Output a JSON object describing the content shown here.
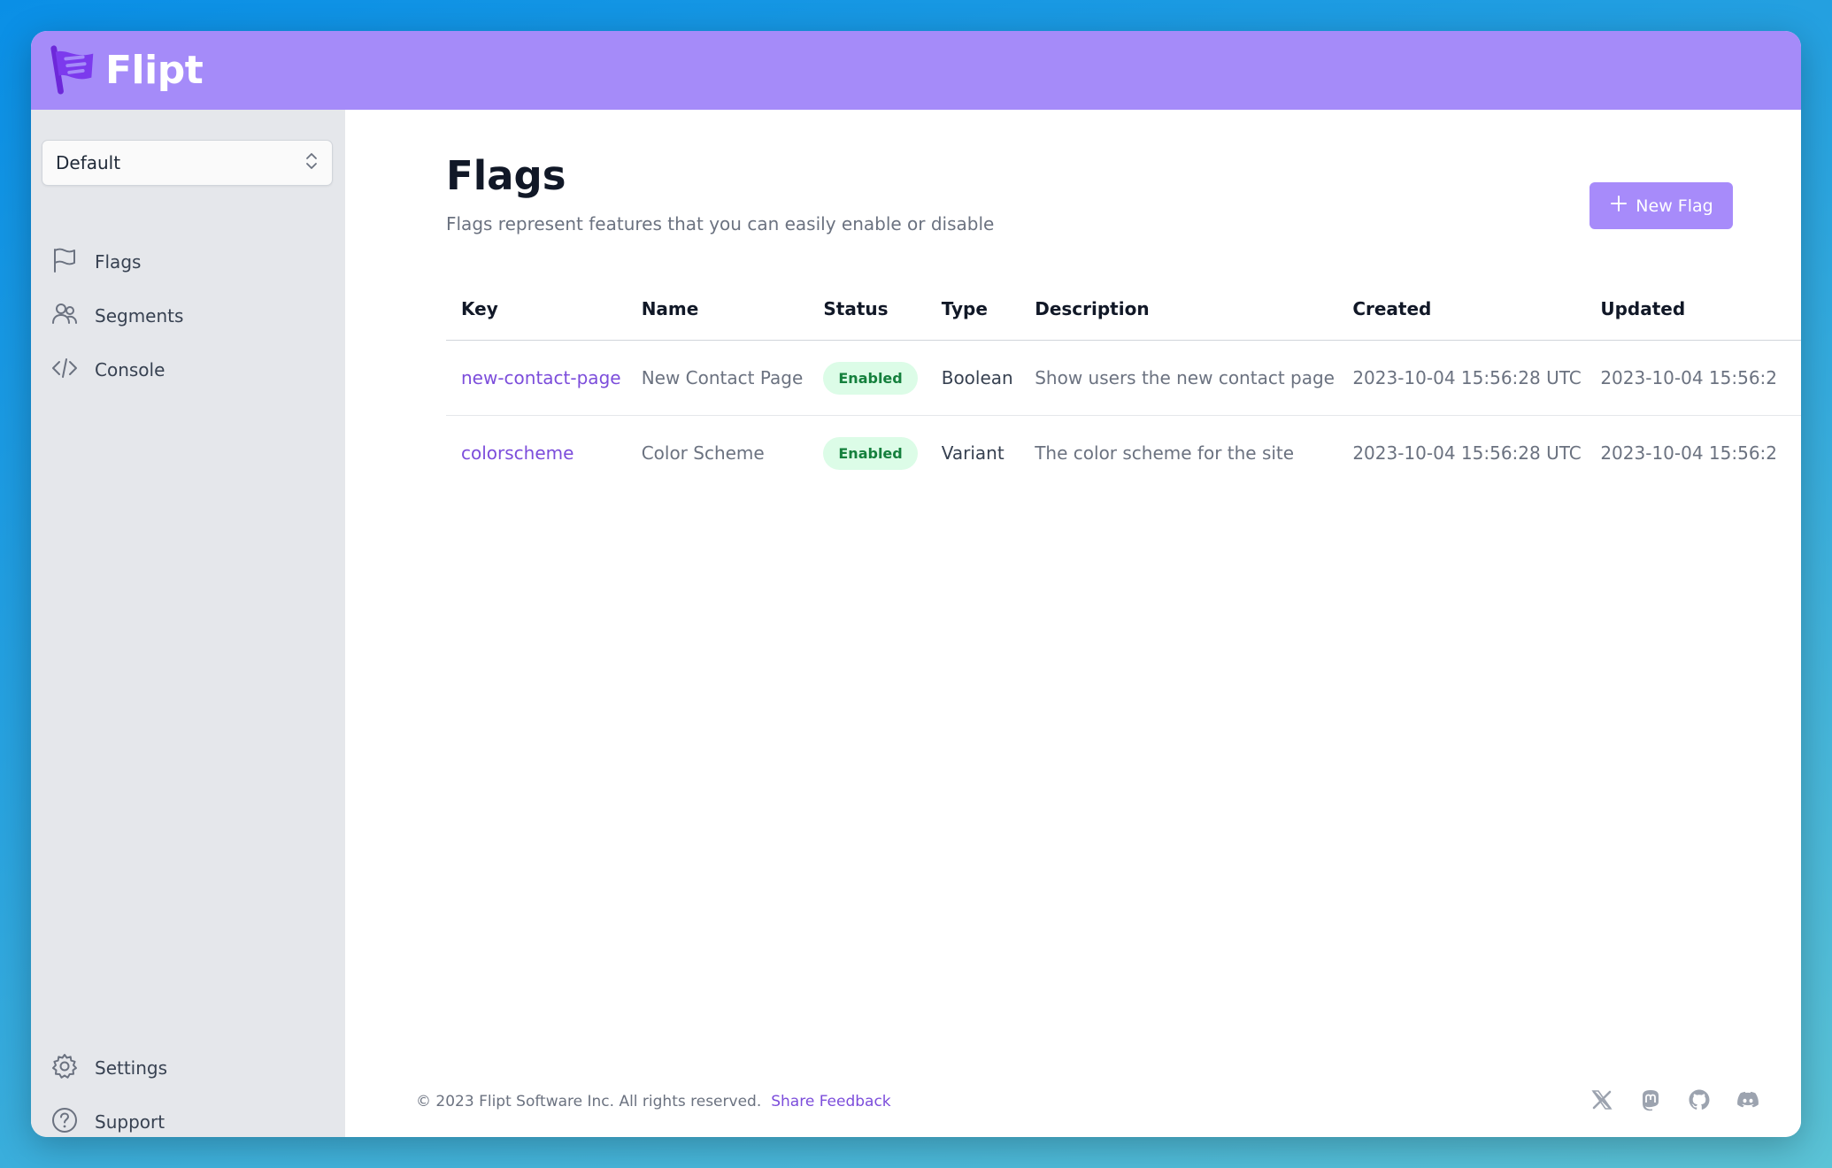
{
  "brand": {
    "name": "Flipt",
    "color": "#a58bf9"
  },
  "sidebar": {
    "namespace_selected": "Default",
    "nav": [
      {
        "label": "Flags",
        "icon": "flag-icon"
      },
      {
        "label": "Segments",
        "icon": "users-icon"
      },
      {
        "label": "Console",
        "icon": "code-icon"
      }
    ],
    "bottom": [
      {
        "label": "Settings",
        "icon": "gear-icon"
      },
      {
        "label": "Support",
        "icon": "question-icon"
      }
    ]
  },
  "page": {
    "title": "Flags",
    "subtitle": "Flags represent features that you can easily enable or disable",
    "new_button": "New Flag"
  },
  "table": {
    "headers": [
      "Key",
      "Name",
      "Status",
      "Type",
      "Description",
      "Created",
      "Updated"
    ],
    "rows": [
      {
        "key": "new-contact-page",
        "name": "New Contact Page",
        "status": "Enabled",
        "type": "Boolean",
        "description": "Show users the new contact page",
        "created": "2023-10-04 15:56:28 UTC",
        "updated": "2023-10-04 15:56:2"
      },
      {
        "key": "colorscheme",
        "name": "Color Scheme",
        "status": "Enabled",
        "type": "Variant",
        "description": "The color scheme for the site",
        "created": "2023-10-04 15:56:28 UTC",
        "updated": "2023-10-04 15:56:2"
      }
    ]
  },
  "footer": {
    "copyright": "© 2023 Flipt Software Inc. All rights reserved.",
    "feedback": "Share Feedback",
    "socials": [
      "x-icon",
      "mastodon-icon",
      "github-icon",
      "discord-icon"
    ]
  }
}
